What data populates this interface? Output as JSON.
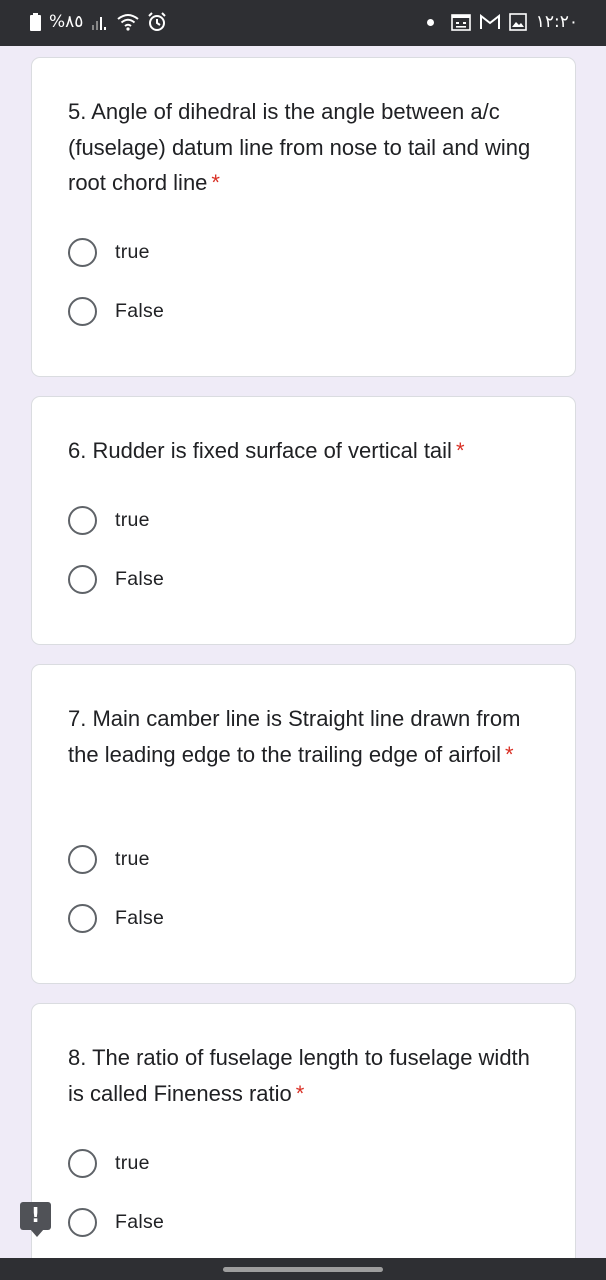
{
  "status_bar": {
    "battery_text": "%٨٥",
    "time": "١٢:٢٠",
    "icons": [
      "battery-icon",
      "signal-icon",
      "wifi-icon",
      "alarm-icon",
      "notification-dot-icon",
      "calendar-icon",
      "gmail-icon",
      "gallery-icon"
    ]
  },
  "questions": [
    {
      "text": "5. Angle of dihedral is the angle between a/c (fuselage) datum line from nose to tail and wing root chord line",
      "required_mark": "*",
      "options": [
        "true",
        "False"
      ]
    },
    {
      "text": "6. Rudder is fixed surface of vertical tail",
      "required_mark": "*",
      "options": [
        "true",
        "False"
      ]
    },
    {
      "text": "7. Main camber line is Straight line drawn from the leading edge to the trailing edge of airfoil",
      "required_mark": "*",
      "options": [
        "true",
        "False"
      ]
    },
    {
      "text": "8. The ratio of fuselage length to fuselage width is called Fineness ratio",
      "required_mark": "*",
      "options": [
        "true",
        "False"
      ]
    }
  ],
  "feedback_button": {
    "glyph": "!"
  },
  "colors": {
    "background": "#efebf7",
    "required": "#d93025",
    "status_bar": "#2e2f33",
    "card_border": "#dadce0"
  }
}
